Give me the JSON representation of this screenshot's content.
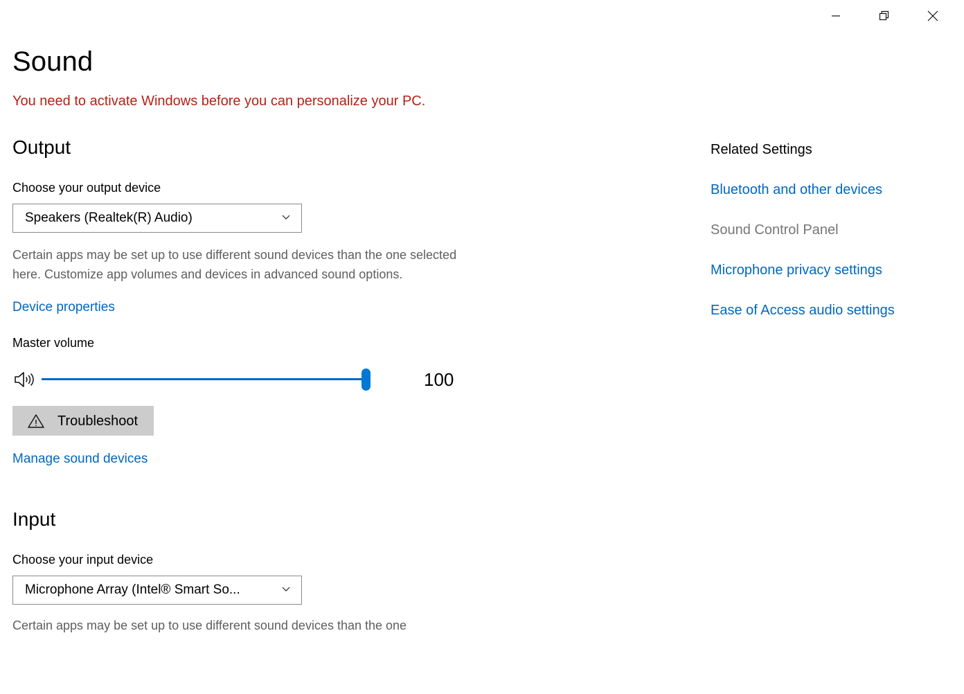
{
  "window": {
    "controls": [
      {
        "name": "minimize",
        "glyph": "minimize-icon",
        "tooltip": "Minimize"
      },
      {
        "name": "restore",
        "glyph": "restore-icon",
        "tooltip": "Restore Down"
      },
      {
        "name": "close",
        "glyph": "close-icon",
        "tooltip": "Close"
      }
    ]
  },
  "page": {
    "title": "Sound",
    "activation_warning": "You need to activate Windows before you can personalize your PC."
  },
  "output": {
    "heading": "Output",
    "device_label": "Choose your output device",
    "device_value": "Speakers (Realtek(R) Audio)",
    "helper_text": "Certain apps may be set up to use different sound devices than the one selected here. Customize app volumes and devices in advanced sound options.",
    "device_properties_link": "Device properties",
    "volume_label": "Master volume",
    "volume_value": "100",
    "volume_percent": 100,
    "volume_icon": "speaker-volume-icon",
    "troubleshoot_label": "Troubleshoot",
    "troubleshoot_icon": "warning-triangle-icon",
    "manage_devices_link": "Manage sound devices"
  },
  "input": {
    "heading": "Input",
    "device_label": "Choose your input device",
    "device_value": "Microphone Array (Intel® Smart So...",
    "helper_text": "Certain apps may be set up to use different sound devices than the one"
  },
  "related_settings": {
    "title": "Related Settings",
    "links": [
      {
        "label": "Bluetooth and other devices",
        "disabled": false
      },
      {
        "label": "Sound Control Panel",
        "disabled": true
      },
      {
        "label": "Microphone privacy settings",
        "disabled": false
      },
      {
        "label": "Ease of Access audio settings",
        "disabled": false
      }
    ]
  },
  "colors": {
    "link": "#0067c0",
    "warning_red": "#b52117",
    "accent": "#0078d4",
    "muted": "#5e5e5e",
    "button_bg": "#cccccc"
  }
}
